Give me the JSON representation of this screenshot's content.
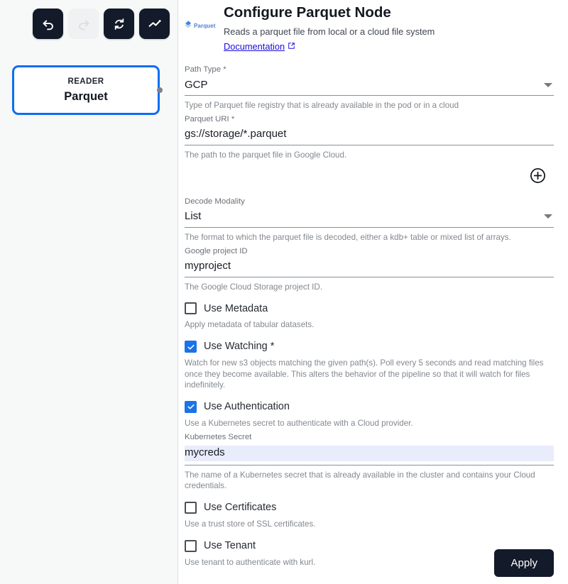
{
  "toolbar": {
    "buttons": [
      {
        "name": "undo",
        "label": "Undo",
        "enabled": true
      },
      {
        "name": "redo",
        "label": "Redo",
        "enabled": false
      },
      {
        "name": "refresh",
        "label": "Refresh",
        "enabled": true
      },
      {
        "name": "activity",
        "label": "Activity",
        "enabled": true
      }
    ]
  },
  "node": {
    "kind": "READER",
    "title": "Parquet"
  },
  "header": {
    "brand": "Parquet",
    "title": "Configure Parquet Node",
    "subtitle": "Reads a parquet file from local or a cloud file system",
    "doc_link": "Documentation"
  },
  "fields": {
    "path_type": {
      "label": "Path Type *",
      "value": "GCP",
      "hint": "Type of Parquet file registry that is already available in the pod or in a cloud"
    },
    "parquet_uri": {
      "label": "Parquet URI *",
      "value": "gs://storage/*.parquet",
      "hint": "The path to the parquet file in Google Cloud."
    },
    "decode_modality": {
      "label": "Decode Modality",
      "value": "List",
      "hint": "The format to which the parquet file is decoded, either a kdb+ table or mixed list of arrays."
    },
    "google_project_id": {
      "label": "Google project ID",
      "value": "myproject",
      "hint": "The Google Cloud Storage project ID."
    },
    "kubernetes_secret": {
      "label": "Kubernetes Secret",
      "value": "mycreds",
      "hint": "The name of a Kubernetes secret that is already available in the cluster and contains your Cloud credentials."
    }
  },
  "checkboxes": {
    "use_metadata": {
      "label": "Use Metadata",
      "checked": false,
      "hint": "Apply metadata of tabular datasets."
    },
    "use_watching": {
      "label": "Use Watching *",
      "checked": true,
      "hint": "Watch for new s3 objects matching the given path(s). Poll every 5 seconds and read matching files once they become available. This alters the behavior of the pipeline so that it will watch for files indefinitely."
    },
    "use_authentication": {
      "label": "Use Authentication",
      "checked": true,
      "hint": "Use a Kubernetes secret to authenticate with a Cloud provider."
    },
    "use_certificates": {
      "label": "Use Certificates",
      "checked": false,
      "hint": "Use a trust store of SSL certificates."
    },
    "use_tenant": {
      "label": "Use Tenant",
      "checked": false,
      "hint": "Use tenant to authenticate with kurl."
    }
  },
  "actions": {
    "apply": "Apply",
    "add": "add-row"
  },
  "colors": {
    "accent_blue": "#1a73e8",
    "node_border": "#0b6ef5",
    "dark": "#131a2a",
    "link": "#1a0dd8",
    "autofill": "#e8ecfb"
  }
}
